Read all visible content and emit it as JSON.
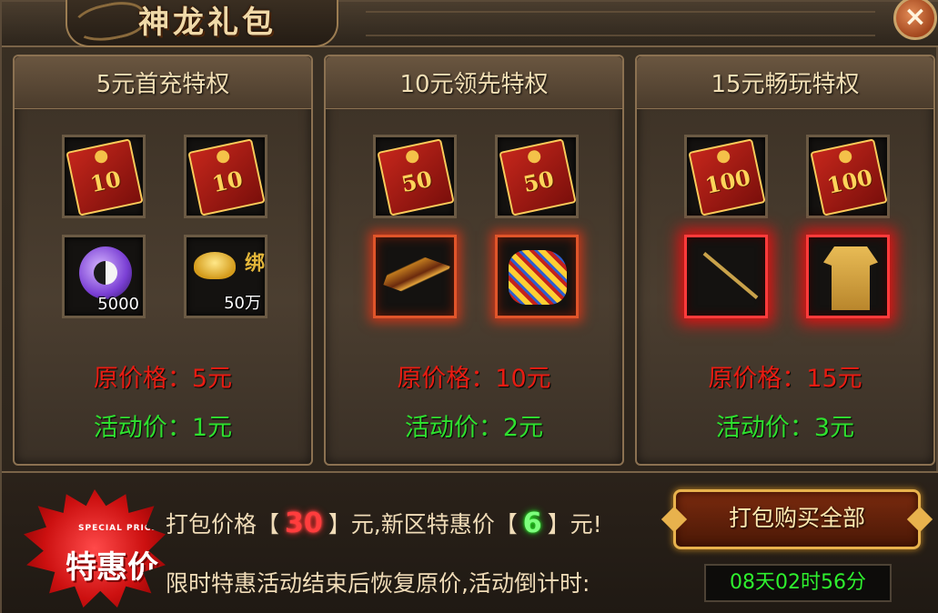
{
  "header": {
    "title": "神龙礼包",
    "close_label": "×"
  },
  "panels": [
    {
      "title": "5元首充特权",
      "original_price": "原价格：5元",
      "sale_price": "活动价：1元",
      "items": [
        {
          "type": "red-envelope",
          "value": "10"
        },
        {
          "type": "red-envelope",
          "value": "10"
        },
        {
          "type": "taiji-orb",
          "qty": "5000"
        },
        {
          "type": "gold-ingot-bound",
          "qty": "50万",
          "bind_label": "绑"
        }
      ]
    },
    {
      "title": "10元领先特权",
      "original_price": "原价格：10元",
      "sale_price": "活动价：2元",
      "items": [
        {
          "type": "red-envelope",
          "value": "50"
        },
        {
          "type": "red-envelope",
          "value": "50"
        },
        {
          "type": "weapon-fire"
        },
        {
          "type": "armor-fire"
        }
      ]
    },
    {
      "title": "15元畅玩特权",
      "original_price": "原价格：15元",
      "sale_price": "活动价：3元",
      "items": [
        {
          "type": "red-envelope",
          "value": "100"
        },
        {
          "type": "red-envelope",
          "value": "100"
        },
        {
          "type": "staff-lightning"
        },
        {
          "type": "robe-lightning"
        }
      ]
    }
  ],
  "bundle": {
    "badge_small": "SPECIAL PRICE",
    "badge_main": "特惠价",
    "line1_prefix": "打包价格【",
    "bundle_price": "30",
    "line1_mid": "】元,新区特惠价【",
    "special_price": "6",
    "line1_suffix": "】元!",
    "line2": "限时特惠活动结束后恢复原价,活动倒计时:",
    "countdown": "08天02时56分",
    "buy_all_label": "打包购买全部"
  },
  "colors": {
    "original_price": "#e81c12",
    "sale_price": "#2fe02f",
    "gold_text": "#f2dfb5"
  }
}
